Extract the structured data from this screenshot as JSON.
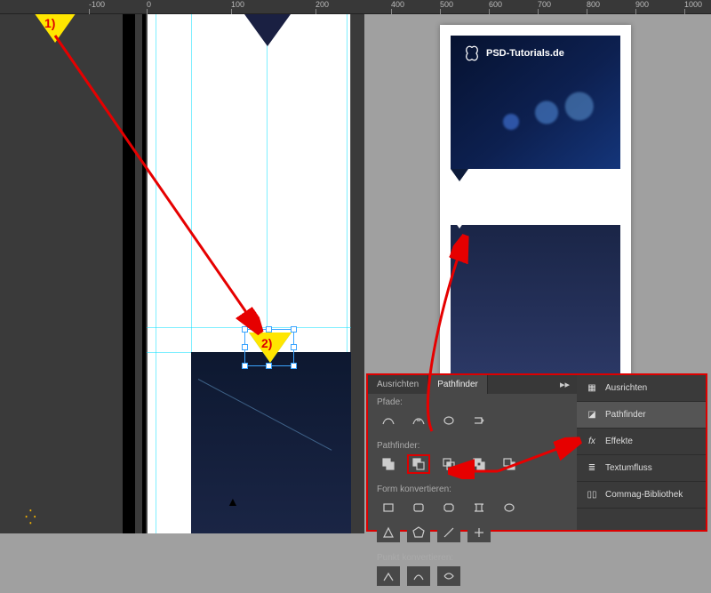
{
  "ruler": {
    "ticks": [
      "-100",
      "0",
      "100",
      "200",
      "400",
      "500",
      "600",
      "700",
      "800",
      "900",
      "1000"
    ]
  },
  "markers": {
    "m1": "1)",
    "m2": "2)"
  },
  "logo_text": "PSD-Tutorials.de",
  "panel": {
    "tabs": {
      "ausrichten": "Ausrichten",
      "pathfinder": "Pathfinder"
    },
    "sections": {
      "pfade": "Pfade:",
      "pathfinder": "Pathfinder:",
      "form": "Form konvertieren:",
      "punkt": "Punkt konvertieren:"
    }
  },
  "panel_list": {
    "ausrichten": "Ausrichten",
    "pathfinder": "Pathfinder",
    "effekte": "Effekte",
    "textumfluss": "Textumfluss",
    "commag": "Commag-Bibliothek"
  }
}
